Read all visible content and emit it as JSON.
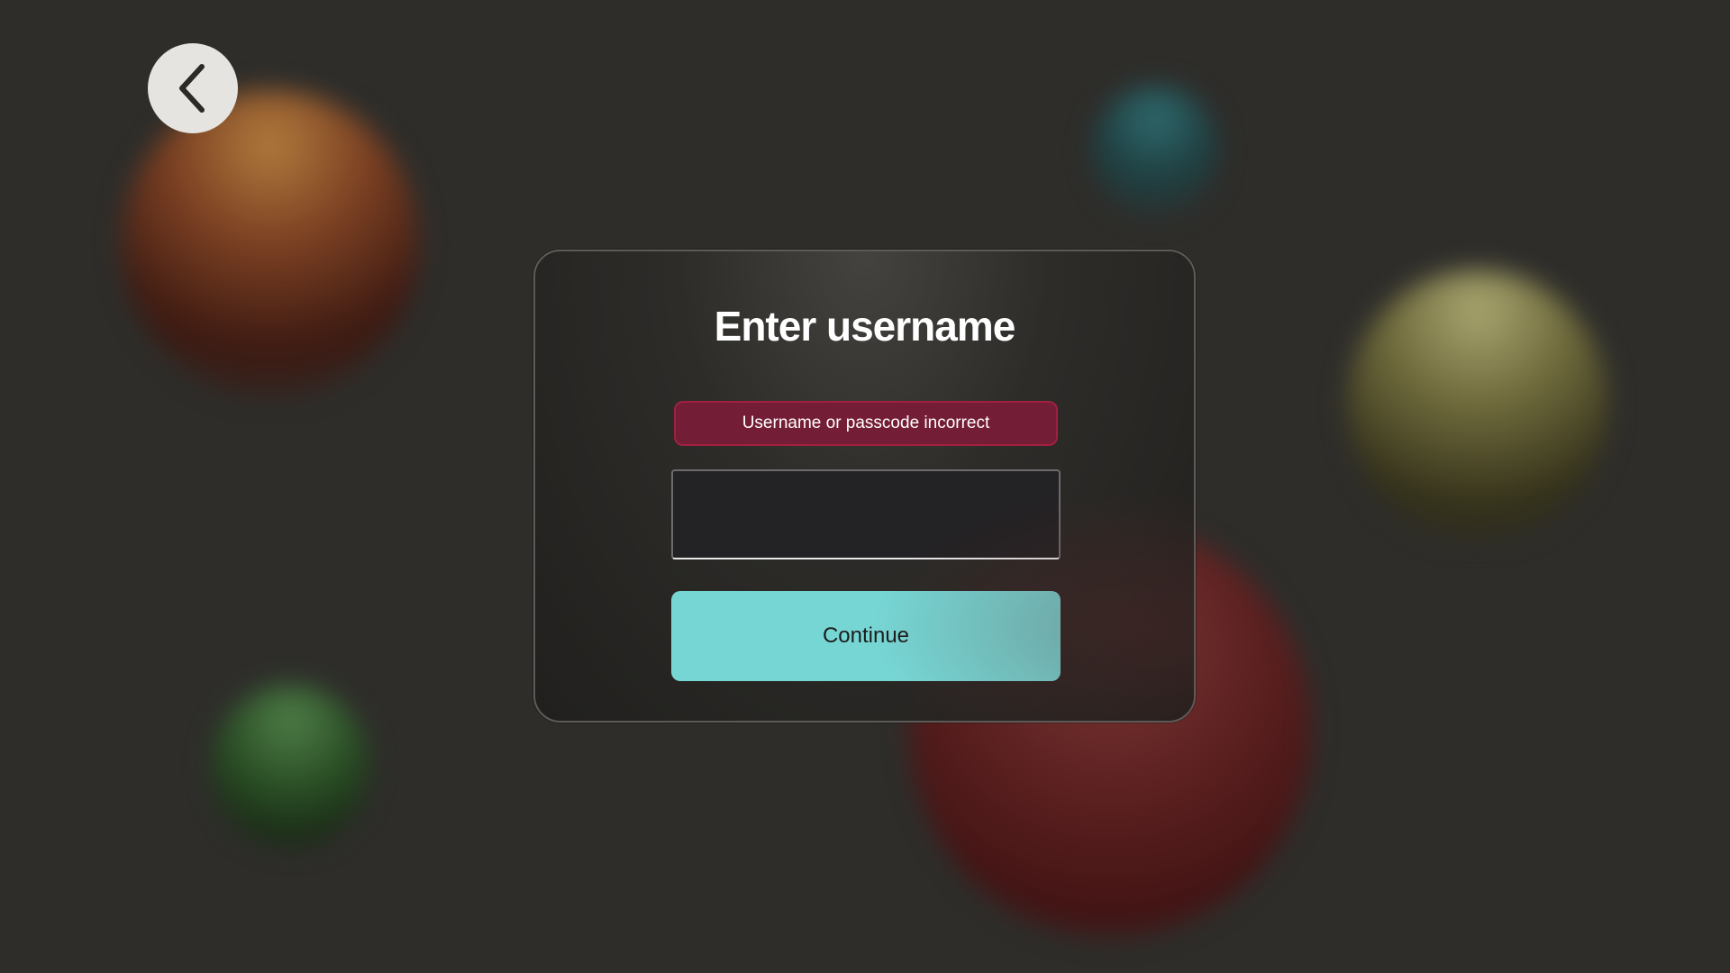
{
  "back": {
    "icon": "chevron-left-icon"
  },
  "dialog": {
    "title": "Enter username",
    "error_message": "Username or passcode incorrect",
    "username_value": "",
    "continue_label": "Continue"
  },
  "colors": {
    "background": "#2e2d2a",
    "error_background": "#741d36",
    "error_border": "#a2203f",
    "accent": "#76d6d4"
  }
}
